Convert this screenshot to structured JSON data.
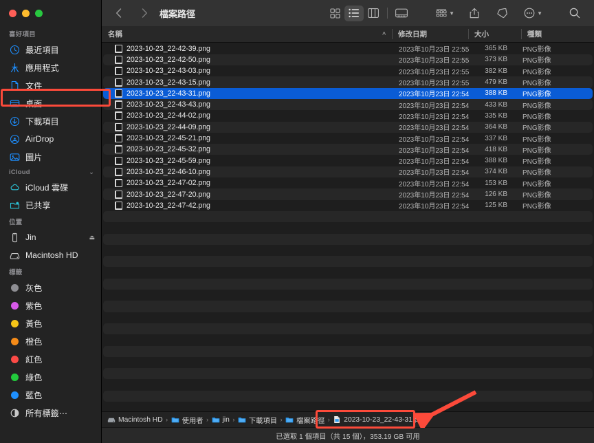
{
  "window": {
    "title": "檔案路徑",
    "traffic_lights": [
      "close",
      "minimize",
      "maximize"
    ]
  },
  "toolbar": {
    "back_label": "‹",
    "forward_label": "›",
    "view_icon_grid": "icon-view-icon",
    "view_icon_list": "list-view-icon",
    "view_icon_column": "column-view-icon",
    "view_icon_gallery": "gallery-view-icon",
    "group_label": "group-by-icon",
    "share_label": "share-icon",
    "tag_label": "tag-icon",
    "more_label": "more-actions-icon",
    "search_label": "search-icon"
  },
  "columns": {
    "name": "名稱",
    "date": "修改日期",
    "size": "大小",
    "kind": "種類",
    "sort_indicator": "^"
  },
  "files": [
    {
      "name": "2023-10-23_22-42-39.png",
      "date": "2023年10月23日 22:55",
      "size": "365 KB",
      "kind": "PNG影像",
      "selected": false
    },
    {
      "name": "2023-10-23_22-42-50.png",
      "date": "2023年10月23日 22:55",
      "size": "373 KB",
      "kind": "PNG影像",
      "selected": false
    },
    {
      "name": "2023-10-23_22-43-03.png",
      "date": "2023年10月23日 22:55",
      "size": "382 KB",
      "kind": "PNG影像",
      "selected": false
    },
    {
      "name": "2023-10-23_22-43-15.png",
      "date": "2023年10月23日 22:55",
      "size": "479 KB",
      "kind": "PNG影像",
      "selected": false
    },
    {
      "name": "2023-10-23_22-43-31.png",
      "date": "2023年10月23日 22:54",
      "size": "388 KB",
      "kind": "PNG影像",
      "selected": true
    },
    {
      "name": "2023-10-23_22-43-43.png",
      "date": "2023年10月23日 22:54",
      "size": "433 KB",
      "kind": "PNG影像",
      "selected": false
    },
    {
      "name": "2023-10-23_22-44-02.png",
      "date": "2023年10月23日 22:54",
      "size": "335 KB",
      "kind": "PNG影像",
      "selected": false
    },
    {
      "name": "2023-10-23_22-44-09.png",
      "date": "2023年10月23日 22:54",
      "size": "364 KB",
      "kind": "PNG影像",
      "selected": false
    },
    {
      "name": "2023-10-23_22-45-21.png",
      "date": "2023年10月23日 22:54",
      "size": "337 KB",
      "kind": "PNG影像",
      "selected": false
    },
    {
      "name": "2023-10-23_22-45-32.png",
      "date": "2023年10月23日 22:54",
      "size": "418 KB",
      "kind": "PNG影像",
      "selected": false
    },
    {
      "name": "2023-10-23_22-45-59.png",
      "date": "2023年10月23日 22:54",
      "size": "388 KB",
      "kind": "PNG影像",
      "selected": false
    },
    {
      "name": "2023-10-23_22-46-10.png",
      "date": "2023年10月23日 22:54",
      "size": "374 KB",
      "kind": "PNG影像",
      "selected": false
    },
    {
      "name": "2023-10-23_22-47-02.png",
      "date": "2023年10月23日 22:54",
      "size": "153 KB",
      "kind": "PNG影像",
      "selected": false
    },
    {
      "name": "2023-10-23_22-47-20.png",
      "date": "2023年10月23日 22:54",
      "size": "126 KB",
      "kind": "PNG影像",
      "selected": false
    },
    {
      "name": "2023-10-23_22-47-42.png",
      "date": "2023年10月23日 22:54",
      "size": "125 KB",
      "kind": "PNG影像",
      "selected": false
    }
  ],
  "sidebar": {
    "sections": [
      {
        "title": "喜好項目",
        "collapsible": false,
        "items": [
          {
            "label": "最近項目",
            "icon": "clock-icon",
            "color": "#1e8fff"
          },
          {
            "label": "應用程式",
            "icon": "applications-icon",
            "color": "#1e8fff"
          },
          {
            "label": "文件",
            "icon": "document-icon",
            "color": "#1e8fff"
          },
          {
            "label": "桌面",
            "icon": "desktop-icon",
            "color": "#1e8fff"
          },
          {
            "label": "下載項目",
            "icon": "download-icon",
            "color": "#1e8fff"
          },
          {
            "label": "AirDrop",
            "icon": "airdrop-icon",
            "color": "#1e8fff"
          },
          {
            "label": "圖片",
            "icon": "pictures-icon",
            "color": "#1e8fff"
          }
        ]
      },
      {
        "title": "iCloud",
        "collapsible": true,
        "items": [
          {
            "label": "iCloud 雲碟",
            "icon": "icloud-drive-icon",
            "color": "#2bc4d8"
          },
          {
            "label": "已共享",
            "icon": "shared-folder-icon",
            "color": "#2bc4d8"
          }
        ]
      },
      {
        "title": "位置",
        "collapsible": false,
        "items": [
          {
            "label": "Jin",
            "icon": "device-icon",
            "color": "#c8c8c8",
            "eject": "⏏"
          },
          {
            "label": "Macintosh HD",
            "icon": "harddisk-icon",
            "color": "#c8c8c8"
          }
        ]
      },
      {
        "title": "標籤",
        "collapsible": false,
        "items": [
          {
            "label": "灰色",
            "icon": "tag-dot-icon",
            "color": "#8e8e93"
          },
          {
            "label": "紫色",
            "icon": "tag-dot-icon",
            "color": "#d659e8"
          },
          {
            "label": "黃色",
            "icon": "tag-dot-icon",
            "color": "#f5c518"
          },
          {
            "label": "橙色",
            "icon": "tag-dot-icon",
            "color": "#f58b18"
          },
          {
            "label": "紅色",
            "icon": "tag-dot-icon",
            "color": "#fc4a46"
          },
          {
            "label": "綠色",
            "icon": "tag-dot-icon",
            "color": "#22c93c"
          },
          {
            "label": "藍色",
            "icon": "tag-dot-icon",
            "color": "#1e90ff"
          },
          {
            "label": "所有標籤⋯",
            "icon": "all-tags-icon",
            "color": "#c8c8c8"
          }
        ]
      }
    ]
  },
  "pathbar": {
    "crumbs": [
      {
        "label": "Macintosh HD",
        "icon": "harddisk-icon"
      },
      {
        "label": "使用者",
        "icon": "folder-icon"
      },
      {
        "label": "jin",
        "icon": "folder-icon"
      },
      {
        "label": "下載項目",
        "icon": "folder-icon"
      },
      {
        "label": "檔案路徑",
        "icon": "folder-icon"
      },
      {
        "label": "2023-10-23_22-43-31.png",
        "icon": "file-icon"
      }
    ],
    "separator": "›"
  },
  "status": {
    "text": "已選取 1 個項目（共 15 個），353.19 GB 可用"
  },
  "annotations": {
    "highlight_color": "#fc4a3a",
    "boxes": [
      "selected-row",
      "path-filename"
    ],
    "arrow": "points-to-path-filename"
  }
}
